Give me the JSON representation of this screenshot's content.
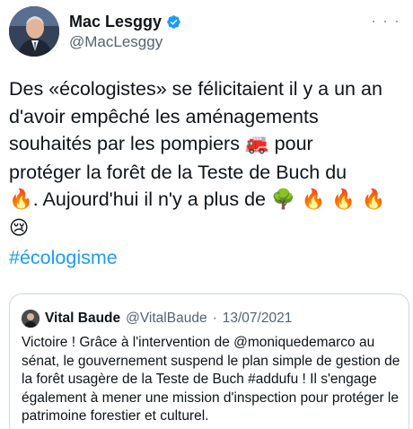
{
  "author": {
    "display_name": "Mac Lesggy",
    "handle": "@MacLesggy",
    "verified_icon": "verified-badge-icon",
    "avatar_icon": "profile-avatar"
  },
  "menu_icon": "more-options-icon",
  "tweet": {
    "line1": "Des «écologistes» se félicitaient il y a un an",
    "line2": "d'avoir empêché les aménagements",
    "line3_text": "souhaités par les pompiers ",
    "line3_emoji": "🚒",
    "line3_end": " pour",
    "line4": "protéger la forêt de la Teste de Buch du",
    "line5_emoji1": "🔥",
    "line5_text": ". Aujourd'hui il n'y a plus de ",
    "line5_emoji2": "🌳",
    "line5_emoji3": " 🔥 🔥 🔥",
    "line6_emoji": "😢",
    "hashtag": "#écologisme"
  },
  "quoted_tweet": {
    "display_name": "Vital Baude",
    "handle": "@VitalBaude",
    "separator": "·",
    "date": "13/07/2021",
    "text": "Victoire ! Grâce à l'intervention de @moniquedemarco au sénat, le gouvernement suspend le plan simple de gestion de la forêt usagère de la Teste de Buch #addufu ! Il s'engage également à mener une mission d'inspection pour protéger le patrimoine forestier et culturel."
  },
  "colors": {
    "text": "#0f1419",
    "secondary": "#536471",
    "link": "#1d9bf0",
    "verified": "#1d9bf0",
    "border": "#cfd9de"
  }
}
